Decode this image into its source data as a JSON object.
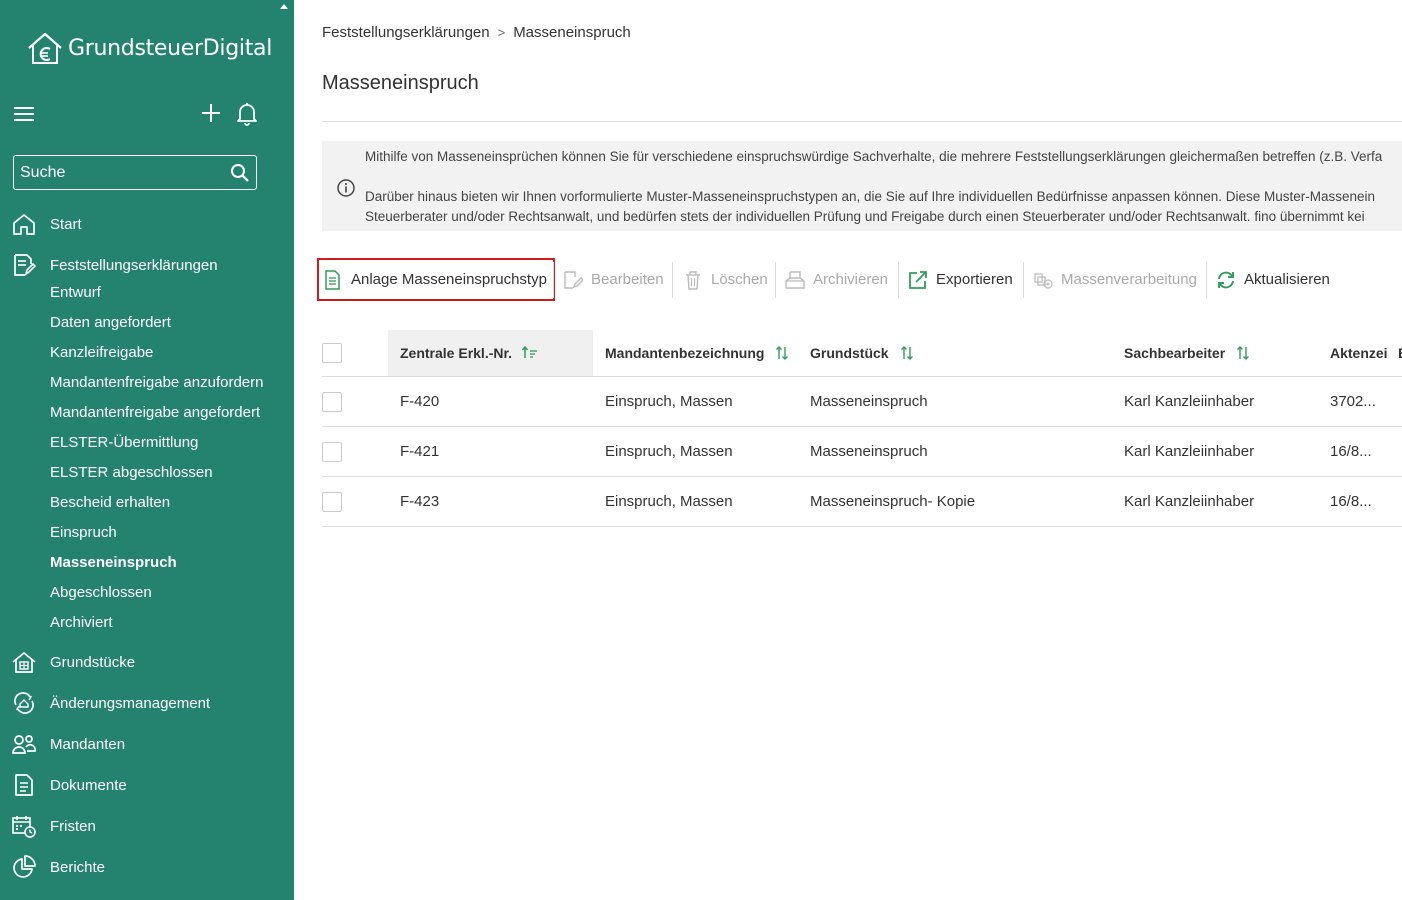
{
  "app": {
    "name": "GrundsteuerDigital"
  },
  "search": {
    "placeholder": "Suche"
  },
  "nav": {
    "start": "Start",
    "feststellung": "Feststellungserklärungen",
    "sub": [
      "Entwurf",
      "Daten angefordert",
      "Kanzleifreigabe",
      "Mandantenfreigabe anzufordern",
      "Mandantenfreigabe angefordert",
      "ELSTER-Übermittlung",
      "ELSTER abgeschlossen",
      "Bescheid erhalten",
      "Einspruch",
      "Masseneinspruch",
      "Abgeschlossen",
      "Archiviert"
    ],
    "active_sub": "Masseneinspruch",
    "grundstuecke": "Grundstücke",
    "aenderung": "Änderungsmanagement",
    "mandanten": "Mandanten",
    "dokumente": "Dokumente",
    "fristen": "Fristen",
    "berichte": "Berichte"
  },
  "breadcrumb": {
    "parent": "Feststellungserklärungen",
    "current": "Masseneinspruch"
  },
  "page": {
    "title": "Masseneinspruch"
  },
  "info": {
    "line1": "Mithilfe von Masseneinsprüchen können Sie für verschiedene einspruchswürdige Sachverhalte, die mehrere Feststellungserklärungen gleichermaßen betreffen (z.B. Verfa",
    "line2": "Darüber hinaus bieten wir Ihnen vorformulierte Muster-Masseneinspruchstypen an, die Sie auf Ihre individuellen Bedürfnisse anpassen können. Diese Muster-Massenein",
    "line3": "Steuerberater und/oder Rechtsanwalt, und bedürfen stets der individuellen Prüfung und Freigabe durch einen Steuerberater und/oder Rechtsanwalt. fino übernimmt kei"
  },
  "toolbar": {
    "anlage": "Anlage Masseneinspruchstyp",
    "bearbeiten": "Bearbeiten",
    "loeschen": "Löschen",
    "archivieren": "Archivieren",
    "exportieren": "Exportieren",
    "massenverarbeitung": "Massenverarbeitung",
    "aktualisieren": "Aktualisieren"
  },
  "table": {
    "columns": [
      "Zentrale Erkl.-Nr.",
      "Mandantenbezeichnung",
      "Grundstück",
      "Sachbearbeiter",
      "Aktenzei",
      "E"
    ],
    "rows": [
      [
        "F-420",
        "Einspruch, Massen",
        "Masseneinspruch",
        "Karl Kanzleiinhaber",
        "3702..."
      ],
      [
        "F-421",
        "Einspruch, Massen",
        "Masseneinspruch",
        "Karl Kanzleiinhaber",
        "16/8..."
      ],
      [
        "F-423",
        "Einspruch, Massen",
        "Masseneinspruch- Kopie",
        "Karl Kanzleiinhaber",
        "16/8..."
      ]
    ]
  },
  "colors": {
    "sidebar": "#23836f",
    "accent": "#1f8a5c",
    "highlight": "#d11a1a"
  }
}
